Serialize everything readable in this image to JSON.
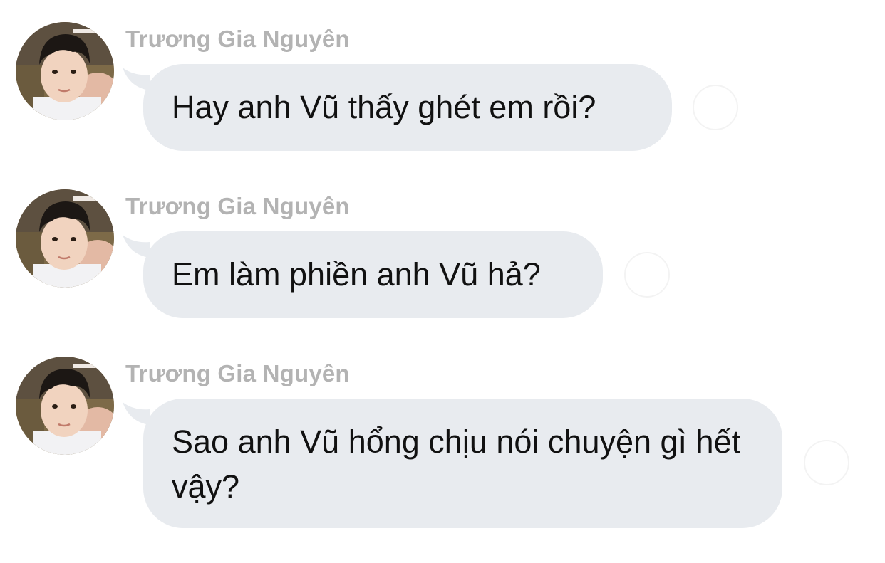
{
  "messages": [
    {
      "sender": "Trương Gia Nguyên",
      "text": "Hay anh Vũ thấy ghét em rồi?"
    },
    {
      "sender": "Trương Gia Nguyên",
      "text": "Em làm phiền anh Vũ hả?"
    },
    {
      "sender": "Trương Gia Nguyên",
      "text": "Sao anh Vũ hổng chịu nói chuyện gì hết vậy?"
    }
  ],
  "icons": {
    "avatar": "child-profile-photo",
    "reaction": "add-reaction-icon"
  },
  "colors": {
    "bubble": "#e8ebef",
    "sender_name": "#b3b3b3",
    "text": "#111111",
    "background": "#ffffff"
  }
}
